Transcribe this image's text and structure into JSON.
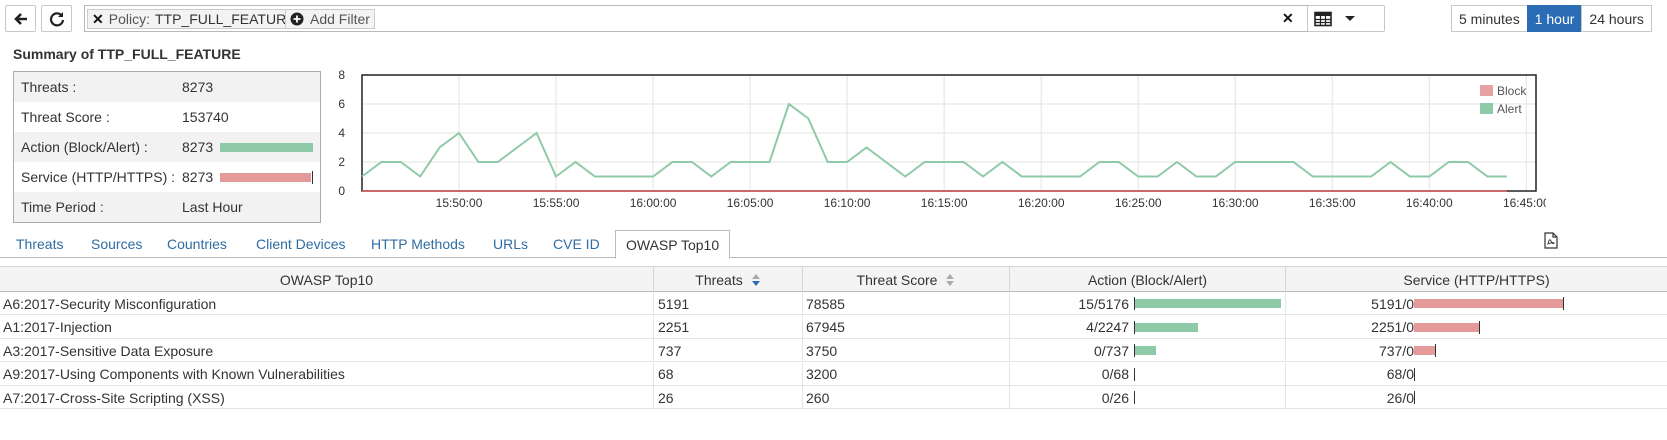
{
  "toolbar": {
    "back_icon": "arrow-left-icon",
    "refresh_icon": "refresh-icon",
    "filter": {
      "chip_remove_icon": "close-icon",
      "policy_key": "Policy:",
      "policy_value": "TTP_FULL_FEATURE",
      "add_filter_icon": "plus-circle-icon",
      "add_filter_label": "Add Filter",
      "clear_icon": "close-icon"
    },
    "view_icon": "table-icon",
    "view_caret_icon": "caret-down-icon",
    "time_ranges": [
      {
        "label": "5 minutes",
        "active": false
      },
      {
        "label": "1 hour",
        "active": true
      },
      {
        "label": "24 hours",
        "active": false
      }
    ]
  },
  "summary": {
    "title": "Summary of TTP_FULL_FEATURE",
    "rows": [
      {
        "key": "Threats :",
        "value": "8273"
      },
      {
        "key": "Threat Score :",
        "value": "153740"
      },
      {
        "key": "Action (Block/Alert) :",
        "value": "8273",
        "bar_color": "#8fcaa8",
        "bar_fraction": 1.0
      },
      {
        "key": "Service (HTTP/HTTPS) :",
        "value": "8273",
        "bar_color": "#e59a9a",
        "bar_fraction": 1.0
      },
      {
        "key": "Time Period :",
        "value": "Last Hour"
      }
    ]
  },
  "chart_data": {
    "type": "line",
    "ylim": [
      0,
      8
    ],
    "yticks": [
      "0",
      "2",
      "4",
      "6",
      "8"
    ],
    "xticks": [
      "15:50:00",
      "15:55:00",
      "16:00:00",
      "16:05:00",
      "16:10:00",
      "16:15:00",
      "16:20:00",
      "16:25:00",
      "16:30:00",
      "16:35:00",
      "16:40:00",
      "16:45:00"
    ],
    "xtick_minutes": [
      50,
      55,
      60,
      65,
      70,
      75,
      80,
      85,
      90,
      95,
      100,
      105
    ],
    "x_minutes": [
      45,
      46,
      47,
      48,
      49,
      50,
      51,
      52,
      53,
      54,
      55,
      56,
      57,
      58,
      59,
      60,
      61,
      62,
      63,
      64,
      65,
      66,
      67,
      68,
      69,
      70,
      71,
      72,
      73,
      74,
      75,
      76,
      77,
      78,
      79,
      80,
      81,
      82,
      83,
      84,
      85,
      86,
      87,
      88,
      89,
      90,
      91,
      92,
      93,
      94,
      95,
      96,
      97,
      98,
      99,
      100,
      101,
      102,
      103,
      104
    ],
    "xlim": [
      45,
      105.5
    ],
    "legend_position": "top-right",
    "grid": true,
    "series": [
      {
        "name": "Block",
        "color": "#e05a5a",
        "legend_color": "#e8a1a1",
        "values": [
          0,
          0,
          0,
          0,
          0,
          0,
          0,
          0,
          0,
          0,
          0,
          0,
          0,
          0,
          0,
          0,
          0,
          0,
          0,
          0,
          0,
          0,
          0,
          0,
          0,
          0,
          0,
          0,
          0,
          0,
          0,
          0,
          0,
          0,
          0,
          0,
          0,
          0,
          0,
          0,
          0,
          0,
          0,
          0,
          0,
          0,
          0,
          0,
          0,
          0,
          0,
          0,
          0,
          0,
          0,
          0,
          0,
          0,
          0,
          0
        ]
      },
      {
        "name": "Alert",
        "color": "#8fcaa8",
        "legend_color": "#8fcaa8",
        "values": [
          1,
          2,
          2,
          1,
          3,
          4,
          2,
          2,
          3,
          4,
          1,
          2,
          1,
          1,
          1,
          1,
          2,
          2,
          1,
          2,
          2,
          2,
          6,
          5,
          2,
          2,
          3,
          2,
          1,
          2,
          2,
          2,
          1,
          2,
          1,
          1,
          1,
          1,
          2,
          2,
          1,
          1,
          2,
          1,
          1,
          2,
          2,
          2,
          2,
          1,
          1,
          1,
          1,
          2,
          1,
          1,
          2,
          2,
          1,
          1
        ]
      }
    ]
  },
  "tabs": {
    "items": [
      {
        "label": "Threats",
        "active": false
      },
      {
        "label": "Sources",
        "active": false
      },
      {
        "label": "Countries",
        "active": false
      },
      {
        "label": "Client Devices",
        "active": false
      },
      {
        "label": "HTTP Methods",
        "active": false
      },
      {
        "label": "URLs",
        "active": false
      },
      {
        "label": "CVE ID",
        "active": false
      },
      {
        "label": "OWASP Top10",
        "active": true
      }
    ],
    "pdf_icon": "pdf-icon"
  },
  "table": {
    "columns": [
      "OWASP Top10",
      "Threats",
      "Threat Score",
      "Action (Block/Alert)",
      "Service (HTTP/HTTPS)"
    ],
    "sort_icons": [
      "sort-desc-icon",
      "sort-icon"
    ],
    "sort_colors": {
      "active": "#2b6db4",
      "inactive": "#aaaaaa"
    },
    "rows": [
      {
        "name": "A6:2017-Security Misconfiguration",
        "threats": "5191",
        "score": "78585",
        "action": "15/5176",
        "action_frac": 1.0,
        "service": "5191/0",
        "service_frac": 1.0
      },
      {
        "name": "A1:2017-Injection",
        "threats": "2251",
        "score": "67945",
        "action": "4/2247",
        "action_frac": 0.434,
        "service": "2251/0",
        "service_frac": 0.434
      },
      {
        "name": "A3:2017-Sensitive Data Exposure",
        "threats": "737",
        "score": "3750",
        "action": "0/737",
        "action_frac": 0.142,
        "service": "737/0",
        "service_frac": 0.142
      },
      {
        "name": "A9:2017-Using Components with Known Vulnerabilities",
        "threats": "68",
        "score": "3200",
        "action": "0/68",
        "action_frac": 0.0,
        "service": "68/0",
        "service_frac": 0.0
      },
      {
        "name": "A7:2017-Cross-Site Scripting (XSS)",
        "threats": "26",
        "score": "260",
        "action": "0/26",
        "action_frac": 0.0,
        "service": "26/0",
        "service_frac": 0.0
      }
    ]
  }
}
